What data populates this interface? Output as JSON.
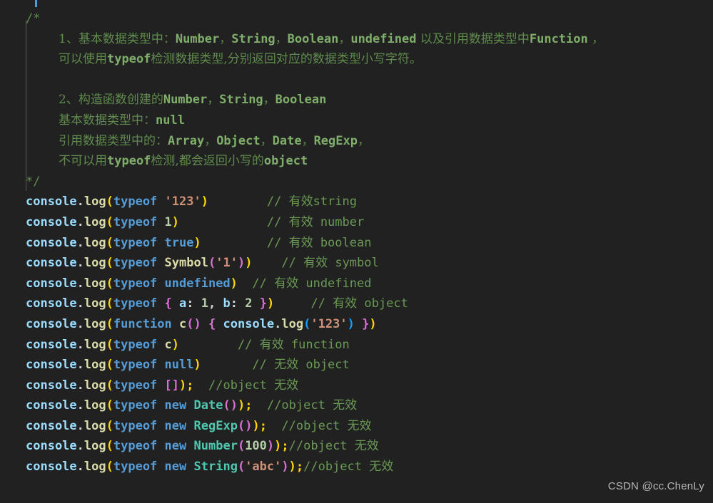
{
  "editor": {
    "background": "#212121",
    "watermark": "CSDN @cc.ChenLy"
  },
  "comment_block": {
    "open": "/*",
    "close": "*/",
    "lines": [
      {
        "id": "c1a",
        "segments": [
          {
            "text": "1、基本数据类型中：",
            "style": "cjk"
          },
          {
            "text": "Number",
            "style": "mono"
          },
          {
            "text": "，",
            "style": "cjk"
          },
          {
            "text": "String",
            "style": "mono"
          },
          {
            "text": "，",
            "style": "cjk"
          },
          {
            "text": "Boolean",
            "style": "mono"
          },
          {
            "text": "，",
            "style": "cjk"
          },
          {
            "text": "undefined",
            "style": "mono"
          },
          {
            "text": " 以及引用数据类型中",
            "style": "cjk"
          },
          {
            "text": "Function",
            "style": "mono"
          },
          {
            "text": " ，",
            "style": "cjk"
          }
        ]
      },
      {
        "id": "c1b",
        "segments": [
          {
            "text": "可以使用",
            "style": "cjk"
          },
          {
            "text": "typeof",
            "style": "mono"
          },
          {
            "text": "检测数据类型,分别返回对应的数据类型小写字符。",
            "style": "cjk"
          }
        ]
      },
      {
        "id": "blank1",
        "segments": []
      },
      {
        "id": "c2a",
        "segments": [
          {
            "text": "2、构造函数创建的",
            "style": "cjk"
          },
          {
            "text": "Number",
            "style": "mono"
          },
          {
            "text": "，",
            "style": "cjk"
          },
          {
            "text": "String",
            "style": "mono"
          },
          {
            "text": "，",
            "style": "cjk"
          },
          {
            "text": "Boolean",
            "style": "mono"
          }
        ]
      },
      {
        "id": "c2b",
        "segments": [
          {
            "text": "基本数据类型中：",
            "style": "cjk"
          },
          {
            "text": "null",
            "style": "mono"
          }
        ]
      },
      {
        "id": "c2c",
        "segments": [
          {
            "text": "引用数据类型中的：",
            "style": "cjk"
          },
          {
            "text": "Array",
            "style": "mono"
          },
          {
            "text": "，",
            "style": "cjk"
          },
          {
            "text": "Object",
            "style": "mono"
          },
          {
            "text": "，",
            "style": "cjk"
          },
          {
            "text": "Date",
            "style": "mono"
          },
          {
            "text": "，",
            "style": "cjk"
          },
          {
            "text": "RegExp",
            "style": "mono"
          },
          {
            "text": "，",
            "style": "cjk"
          }
        ]
      },
      {
        "id": "c2d",
        "segments": [
          {
            "text": "不可以用",
            "style": "cjk"
          },
          {
            "text": "typeof",
            "style": "mono"
          },
          {
            "text": "检测,都会返回小写的",
            "style": "cjk"
          },
          {
            "text": "object",
            "style": "mono"
          }
        ]
      }
    ]
  },
  "code_lines": [
    {
      "id": "line-typeof-string",
      "tokens": [
        {
          "t": "console",
          "c": "c-console"
        },
        {
          "t": ".",
          "c": "c-punct"
        },
        {
          "t": "log",
          "c": "c-prop"
        },
        {
          "t": "(",
          "c": "b-gold"
        },
        {
          "t": "typeof",
          "c": "c-kw"
        },
        {
          "t": " ",
          "c": "c-punct"
        },
        {
          "t": "'123'",
          "c": "c-str"
        },
        {
          "t": ")",
          "c": "b-gold"
        },
        {
          "t": "        ",
          "c": "c-punct"
        },
        {
          "t": "// 有效string",
          "c": "cmt-green"
        }
      ]
    },
    {
      "id": "line-typeof-number",
      "tokens": [
        {
          "t": "console",
          "c": "c-console"
        },
        {
          "t": ".",
          "c": "c-punct"
        },
        {
          "t": "log",
          "c": "c-prop"
        },
        {
          "t": "(",
          "c": "b-gold"
        },
        {
          "t": "typeof",
          "c": "c-kw"
        },
        {
          "t": " ",
          "c": "c-punct"
        },
        {
          "t": "1",
          "c": "c-num"
        },
        {
          "t": ")",
          "c": "b-gold"
        },
        {
          "t": "            ",
          "c": "c-punct"
        },
        {
          "t": "// 有效 number",
          "c": "cmt-green"
        }
      ]
    },
    {
      "id": "line-typeof-boolean",
      "tokens": [
        {
          "t": "console",
          "c": "c-console"
        },
        {
          "t": ".",
          "c": "c-punct"
        },
        {
          "t": "log",
          "c": "c-prop"
        },
        {
          "t": "(",
          "c": "b-gold"
        },
        {
          "t": "typeof",
          "c": "c-kw"
        },
        {
          "t": " ",
          "c": "c-punct"
        },
        {
          "t": "true",
          "c": "c-kw"
        },
        {
          "t": ")",
          "c": "b-gold"
        },
        {
          "t": "         ",
          "c": "c-punct"
        },
        {
          "t": "// 有效 boolean",
          "c": "cmt-green"
        }
      ]
    },
    {
      "id": "line-typeof-symbol",
      "tokens": [
        {
          "t": "console",
          "c": "c-console"
        },
        {
          "t": ".",
          "c": "c-punct"
        },
        {
          "t": "log",
          "c": "c-prop"
        },
        {
          "t": "(",
          "c": "b-gold"
        },
        {
          "t": "typeof",
          "c": "c-kw"
        },
        {
          "t": " ",
          "c": "c-punct"
        },
        {
          "t": "Symbol",
          "c": "c-fn"
        },
        {
          "t": "(",
          "c": "b-pink"
        },
        {
          "t": "'1'",
          "c": "c-str"
        },
        {
          "t": ")",
          "c": "b-pink"
        },
        {
          "t": ")",
          "c": "b-gold"
        },
        {
          "t": "    ",
          "c": "c-punct"
        },
        {
          "t": "// 有效 symbol",
          "c": "cmt-green"
        }
      ]
    },
    {
      "id": "line-typeof-undefined",
      "tokens": [
        {
          "t": "console",
          "c": "c-console"
        },
        {
          "t": ".",
          "c": "c-punct"
        },
        {
          "t": "log",
          "c": "c-prop"
        },
        {
          "t": "(",
          "c": "b-gold"
        },
        {
          "t": "typeof",
          "c": "c-kw"
        },
        {
          "t": " ",
          "c": "c-punct"
        },
        {
          "t": "undefined",
          "c": "c-kw"
        },
        {
          "t": ")",
          "c": "b-gold"
        },
        {
          "t": "  ",
          "c": "c-punct"
        },
        {
          "t": "// 有效 undefined",
          "c": "cmt-green"
        }
      ]
    },
    {
      "id": "line-typeof-object",
      "tokens": [
        {
          "t": "console",
          "c": "c-console"
        },
        {
          "t": ".",
          "c": "c-punct"
        },
        {
          "t": "log",
          "c": "c-prop"
        },
        {
          "t": "(",
          "c": "b-gold"
        },
        {
          "t": "typeof",
          "c": "c-kw"
        },
        {
          "t": " ",
          "c": "c-punct"
        },
        {
          "t": "{",
          "c": "b-pink"
        },
        {
          "t": " a",
          "c": "c-console"
        },
        {
          "t": ":",
          "c": "c-punct"
        },
        {
          "t": " ",
          "c": "c-punct"
        },
        {
          "t": "1",
          "c": "c-num"
        },
        {
          "t": ",",
          "c": "c-punct"
        },
        {
          "t": " b",
          "c": "c-console"
        },
        {
          "t": ":",
          "c": "c-punct"
        },
        {
          "t": " ",
          "c": "c-punct"
        },
        {
          "t": "2",
          "c": "c-num"
        },
        {
          "t": " ",
          "c": "c-punct"
        },
        {
          "t": "}",
          "c": "b-pink"
        },
        {
          "t": ")",
          "c": "b-gold"
        },
        {
          "t": "     ",
          "c": "c-punct"
        },
        {
          "t": "// 有效 object",
          "c": "cmt-green"
        }
      ]
    },
    {
      "id": "line-function-c",
      "tokens": [
        {
          "t": "console",
          "c": "c-console"
        },
        {
          "t": ".",
          "c": "c-punct"
        },
        {
          "t": "log",
          "c": "c-prop"
        },
        {
          "t": "(",
          "c": "b-gold"
        },
        {
          "t": "function",
          "c": "c-kw"
        },
        {
          "t": " ",
          "c": "c-punct"
        },
        {
          "t": "c",
          "c": "c-fn"
        },
        {
          "t": "(",
          "c": "b-pink"
        },
        {
          "t": ")",
          "c": "b-pink"
        },
        {
          "t": " ",
          "c": "c-punct"
        },
        {
          "t": "{",
          "c": "b-pink"
        },
        {
          "t": " ",
          "c": "c-punct"
        },
        {
          "t": "console",
          "c": "c-console"
        },
        {
          "t": ".",
          "c": "c-punct"
        },
        {
          "t": "log",
          "c": "c-prop"
        },
        {
          "t": "(",
          "c": "b-blue"
        },
        {
          "t": "'123'",
          "c": "c-str"
        },
        {
          "t": ")",
          "c": "b-blue"
        },
        {
          "t": " ",
          "c": "c-punct"
        },
        {
          "t": "}",
          "c": "b-pink"
        },
        {
          "t": ")",
          "c": "b-gold"
        }
      ]
    },
    {
      "id": "line-typeof-c",
      "tokens": [
        {
          "t": "console",
          "c": "c-console"
        },
        {
          "t": ".",
          "c": "c-punct"
        },
        {
          "t": "log",
          "c": "c-prop"
        },
        {
          "t": "(",
          "c": "b-gold"
        },
        {
          "t": "typeof",
          "c": "c-kw"
        },
        {
          "t": " ",
          "c": "c-punct"
        },
        {
          "t": "c",
          "c": "c-fn"
        },
        {
          "t": ")",
          "c": "b-gold"
        },
        {
          "t": "        ",
          "c": "c-punct"
        },
        {
          "t": "// 有效 function",
          "c": "cmt-green"
        }
      ]
    },
    {
      "id": "line-typeof-null",
      "tokens": [
        {
          "t": "console",
          "c": "c-console"
        },
        {
          "t": ".",
          "c": "c-punct"
        },
        {
          "t": "log",
          "c": "c-prop"
        },
        {
          "t": "(",
          "c": "b-gold"
        },
        {
          "t": "typeof",
          "c": "c-kw"
        },
        {
          "t": " ",
          "c": "c-punct"
        },
        {
          "t": "null",
          "c": "c-kw"
        },
        {
          "t": ")",
          "c": "b-gold"
        },
        {
          "t": "       ",
          "c": "c-punct"
        },
        {
          "t": "// 无效 object",
          "c": "cmt-green"
        }
      ]
    },
    {
      "id": "line-typeof-array",
      "tokens": [
        {
          "t": "console",
          "c": "c-console"
        },
        {
          "t": ".",
          "c": "c-punct"
        },
        {
          "t": "log",
          "c": "c-prop"
        },
        {
          "t": "(",
          "c": "b-gold"
        },
        {
          "t": "typeof",
          "c": "c-kw"
        },
        {
          "t": " ",
          "c": "c-punct"
        },
        {
          "t": "[",
          "c": "b-pink"
        },
        {
          "t": "]",
          "c": "b-pink"
        },
        {
          "t": ")",
          "c": "b-gold"
        },
        {
          "t": ";",
          "c": "c-semi"
        },
        {
          "t": "  ",
          "c": "c-punct"
        },
        {
          "t": "//object 无效",
          "c": "cmt-green"
        }
      ]
    },
    {
      "id": "line-typeof-date",
      "tokens": [
        {
          "t": "console",
          "c": "c-console"
        },
        {
          "t": ".",
          "c": "c-punct"
        },
        {
          "t": "log",
          "c": "c-prop"
        },
        {
          "t": "(",
          "c": "b-gold"
        },
        {
          "t": "typeof",
          "c": "c-kw"
        },
        {
          "t": " ",
          "c": "c-punct"
        },
        {
          "t": "new",
          "c": "c-kw"
        },
        {
          "t": " ",
          "c": "c-punct"
        },
        {
          "t": "Date",
          "c": "c-class"
        },
        {
          "t": "(",
          "c": "b-pink"
        },
        {
          "t": ")",
          "c": "b-pink"
        },
        {
          "t": ")",
          "c": "b-gold"
        },
        {
          "t": ";",
          "c": "c-semi"
        },
        {
          "t": "  ",
          "c": "c-punct"
        },
        {
          "t": "//object 无效",
          "c": "cmt-green"
        }
      ]
    },
    {
      "id": "line-typeof-regexp",
      "tokens": [
        {
          "t": "console",
          "c": "c-console"
        },
        {
          "t": ".",
          "c": "c-punct"
        },
        {
          "t": "log",
          "c": "c-prop"
        },
        {
          "t": "(",
          "c": "b-gold"
        },
        {
          "t": "typeof",
          "c": "c-kw"
        },
        {
          "t": " ",
          "c": "c-punct"
        },
        {
          "t": "new",
          "c": "c-kw"
        },
        {
          "t": " ",
          "c": "c-punct"
        },
        {
          "t": "RegExp",
          "c": "c-class"
        },
        {
          "t": "(",
          "c": "b-pink"
        },
        {
          "t": ")",
          "c": "b-pink"
        },
        {
          "t": ")",
          "c": "b-gold"
        },
        {
          "t": ";",
          "c": "c-semi"
        },
        {
          "t": "  ",
          "c": "c-punct"
        },
        {
          "t": "//object 无效",
          "c": "cmt-green"
        }
      ]
    },
    {
      "id": "line-typeof-number-obj",
      "tokens": [
        {
          "t": "console",
          "c": "c-console"
        },
        {
          "t": ".",
          "c": "c-punct"
        },
        {
          "t": "log",
          "c": "c-prop"
        },
        {
          "t": "(",
          "c": "b-gold"
        },
        {
          "t": "typeof",
          "c": "c-kw"
        },
        {
          "t": " ",
          "c": "c-punct"
        },
        {
          "t": "new",
          "c": "c-kw"
        },
        {
          "t": " ",
          "c": "c-punct"
        },
        {
          "t": "Number",
          "c": "c-class"
        },
        {
          "t": "(",
          "c": "b-pink"
        },
        {
          "t": "100",
          "c": "c-num"
        },
        {
          "t": ")",
          "c": "b-pink"
        },
        {
          "t": ")",
          "c": "b-gold"
        },
        {
          "t": ";",
          "c": "c-semi"
        },
        {
          "t": "//object 无效",
          "c": "cmt-green"
        }
      ]
    },
    {
      "id": "line-typeof-string-obj",
      "tokens": [
        {
          "t": "console",
          "c": "c-console"
        },
        {
          "t": ".",
          "c": "c-punct"
        },
        {
          "t": "log",
          "c": "c-prop"
        },
        {
          "t": "(",
          "c": "b-gold"
        },
        {
          "t": "typeof",
          "c": "c-kw"
        },
        {
          "t": " ",
          "c": "c-punct"
        },
        {
          "t": "new",
          "c": "c-kw"
        },
        {
          "t": " ",
          "c": "c-punct"
        },
        {
          "t": "String",
          "c": "c-class"
        },
        {
          "t": "(",
          "c": "b-pink"
        },
        {
          "t": "'abc'",
          "c": "c-str"
        },
        {
          "t": ")",
          "c": "b-pink"
        },
        {
          "t": ")",
          "c": "b-gold"
        },
        {
          "t": ";",
          "c": "c-semi"
        },
        {
          "t": "//object 无效",
          "c": "cmt-green"
        }
      ]
    }
  ]
}
